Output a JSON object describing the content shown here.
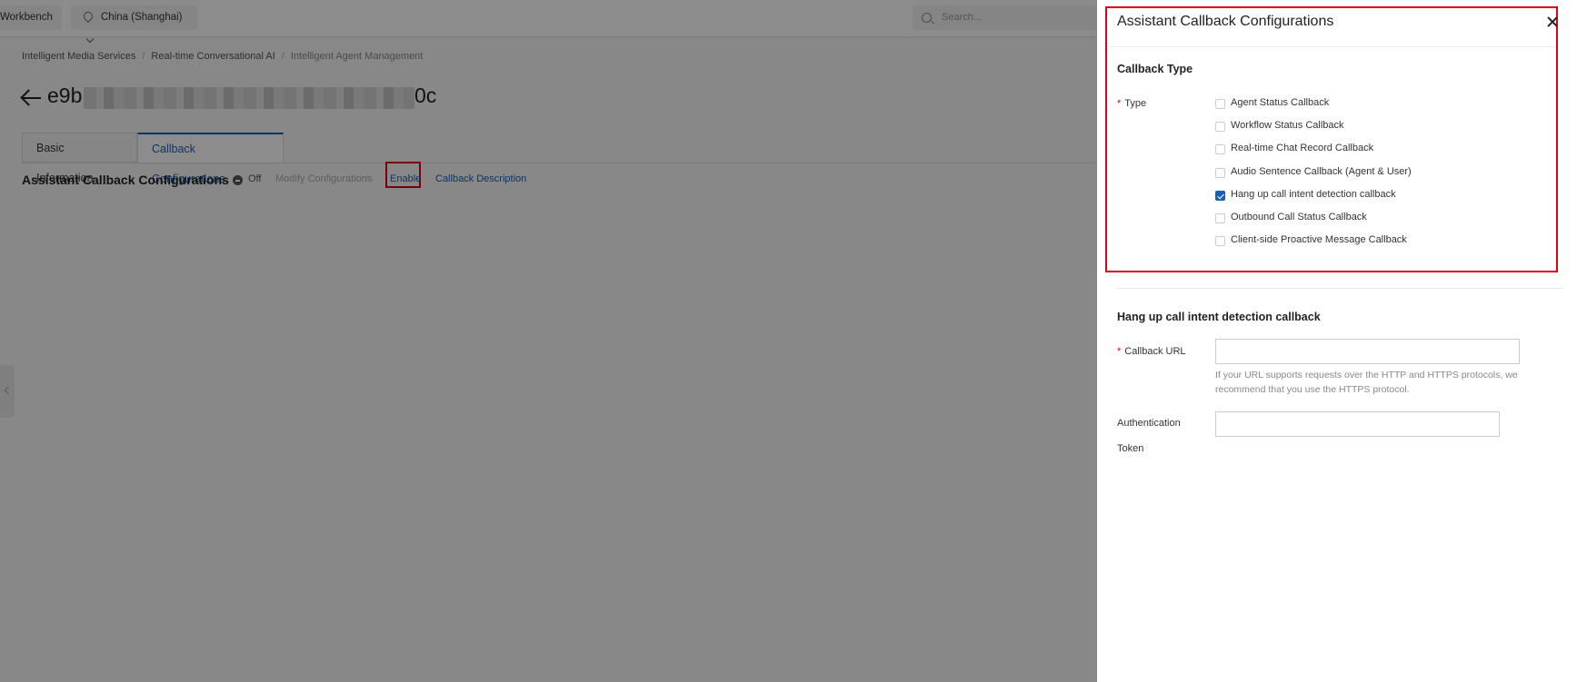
{
  "topbar": {
    "workbench": "Workbench",
    "region": "China (Shanghai)",
    "search_placeholder": "Search..."
  },
  "breadcrumb": [
    "Intelligent Media Services",
    "Real-time Conversational AI",
    "Intelligent Agent Management"
  ],
  "agent_id": {
    "prefix": "e9b",
    "suffix": "0c"
  },
  "tabs": [
    {
      "label": "Basic Information",
      "active": false
    },
    {
      "label": "Callback Configurations",
      "active": true
    }
  ],
  "callback_section": {
    "title": "Assistant Callback Configurations",
    "status": "Off",
    "modify_label": "Modify Configurations",
    "enable_label": "Enable",
    "description_label": "Callback Description"
  },
  "drawer": {
    "title": "Assistant Callback Configurations",
    "callback_type_heading": "Callback Type",
    "type_label": "Type",
    "required_mark": "*",
    "types": [
      {
        "label": "Agent Status Callback",
        "checked": false
      },
      {
        "label": "Workflow Status Callback",
        "checked": false
      },
      {
        "label": "Real-time Chat Record Callback",
        "checked": false
      },
      {
        "label": "Audio Sentence Callback (Agent & User)",
        "checked": false
      },
      {
        "label": "Hang up call intent detection callback",
        "checked": true
      },
      {
        "label": "Outbound Call Status Callback",
        "checked": false
      },
      {
        "label": "Client-side Proactive Message Callback",
        "checked": false
      }
    ],
    "hangup_heading": "Hang up call intent detection callback",
    "callback_url_label": "Callback URL",
    "callback_url_value": "",
    "callback_url_help": "If your URL supports requests over the HTTP and HTTPS protocols, we recommend that you use the HTTPS protocol.",
    "auth_label_line1": "Authentication",
    "auth_label_line2": "Token",
    "auth_value": ""
  },
  "colors": {
    "accent": "#1a5fb4",
    "highlight": "#e0001b",
    "mask": "rgba(0,0,0,0.45)"
  }
}
